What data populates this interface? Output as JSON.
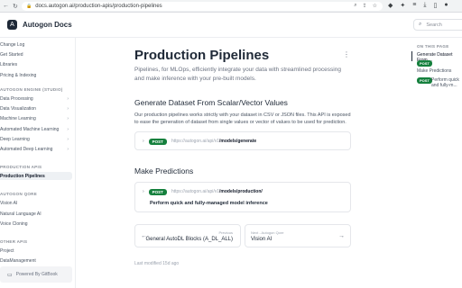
{
  "browser": {
    "url": "docs.autogon.ai/production-apis/production-pipelines",
    "nav_back": "←",
    "nav_reload": "↻"
  },
  "header": {
    "logo_text": "Autogon Docs",
    "search_placeholder": "Search"
  },
  "sidebar": {
    "top_items": [
      "Change Log",
      "Get Started",
      "Libraries",
      "Pricing & Indexing"
    ],
    "section_1": "AUTOGON ENGINE (STUDIO)",
    "section_1_items": [
      "Data Processing",
      "Data Visualization",
      "Machine Learning",
      "Automated Machine Learning",
      "Deep Learning",
      "Automated Deep Learning"
    ],
    "section_2": "PRODUCTION APIS",
    "section_2_items": [
      "Production Pipelines"
    ],
    "section_3": "AUTOGON QORE",
    "section_3_items": [
      "Vision AI",
      "Natural Language AI",
      "Voice Cloning"
    ],
    "section_4": "OTHER APIS",
    "section_4_items": [
      "Project",
      "DataManagement"
    ],
    "powered_by": "Powered By GitBook"
  },
  "main": {
    "title": "Production Pipelines",
    "description": "Pipelines, for MLOps, efficiently integrate your data with streamlined processing and make inference with your pre-built models.",
    "section_1_heading": "Generate Dataset From Scalar/Vector Values",
    "section_1_text": "Our production pipelines works strictly with your dataset in CSV or JSON files. This API is exposed to ease the generation of dataset from single values or vector of values to be used for prediction.",
    "api_1": {
      "method": "POST",
      "base": "https://autogon.ai/api/v1",
      "path": "/models/generate"
    },
    "section_2_heading": "Make Predictions",
    "api_2": {
      "method": "POST",
      "base": "https://autogon.ai/api/v1",
      "path": "/models/production/",
      "summary": "Perform quick and fully-managed model inference"
    },
    "prev": {
      "label": "Previous",
      "title": "General AutoDL Blocks (A_DL_ALL)"
    },
    "next": {
      "label": "Next - Autogon Qore",
      "title": "Vision AI"
    },
    "last_modified": "Last modified 15d ago"
  },
  "toc": {
    "title": "ON THIS PAGE",
    "items": [
      "Generate Dataset From ...",
      "Make Predictions"
    ],
    "badge": "POST",
    "badge_item": "Perform quick and fully-m..."
  },
  "colors": {
    "accent": "#1f2937",
    "post_badge": "#15803d"
  }
}
